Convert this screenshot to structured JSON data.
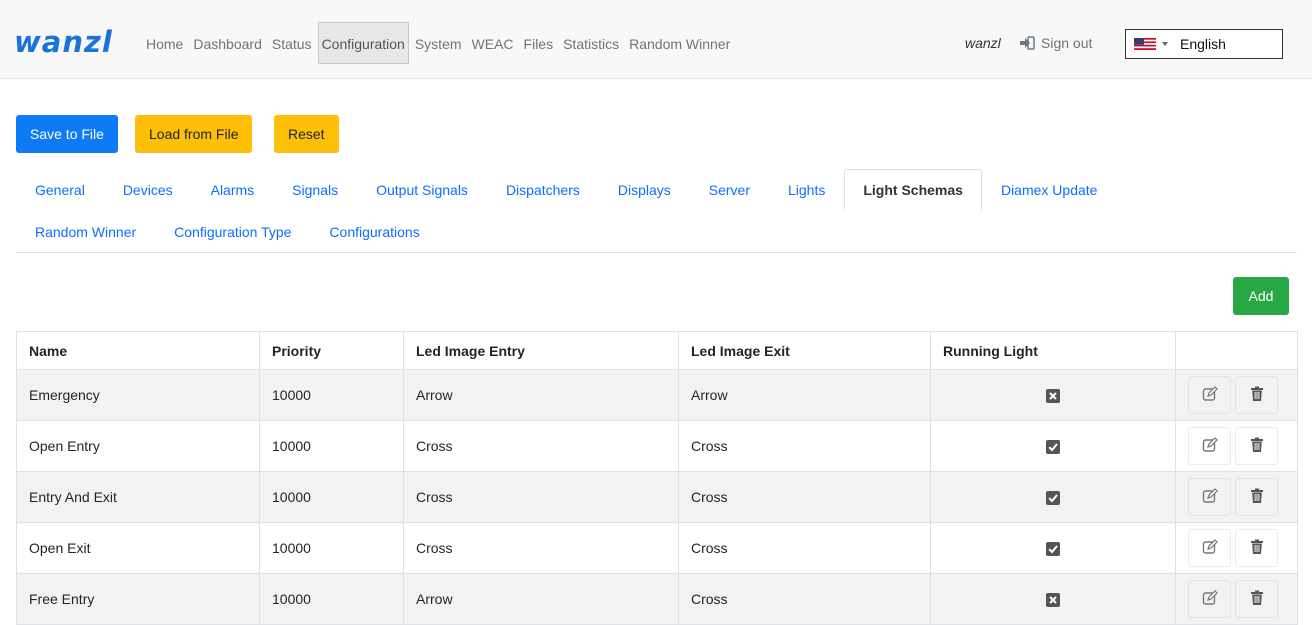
{
  "brand": "wanzl",
  "nav": {
    "links": [
      "Home",
      "Dashboard",
      "Status",
      "Configuration",
      "System",
      "WEAC",
      "Files",
      "Statistics",
      "Random Winner"
    ],
    "active_index": 3,
    "user": "wanzl",
    "signout": "Sign out",
    "language": "English"
  },
  "actions": {
    "save": "Save to File",
    "load": "Load from File",
    "reset": "Reset"
  },
  "tabs": {
    "row1": [
      "General",
      "Devices",
      "Alarms",
      "Signals",
      "Output Signals",
      "Dispatchers",
      "Displays",
      "Server",
      "Lights",
      "Light Schemas",
      "Diamex Update"
    ],
    "row2": [
      "Random Winner",
      "Configuration Type",
      "Configurations"
    ],
    "active": "Light Schemas"
  },
  "add_label": "Add",
  "table": {
    "headers": [
      "Name",
      "Priority",
      "Led Image Entry",
      "Led Image Exit",
      "Running Light",
      ""
    ],
    "rows": [
      {
        "name": "Emergency",
        "priority": "10000",
        "entry": "Arrow",
        "exit": "Arrow",
        "running": false
      },
      {
        "name": "Open Entry",
        "priority": "10000",
        "entry": "Cross",
        "exit": "Cross",
        "running": true
      },
      {
        "name": "Entry And Exit",
        "priority": "10000",
        "entry": "Cross",
        "exit": "Cross",
        "running": true
      },
      {
        "name": "Open Exit",
        "priority": "10000",
        "entry": "Cross",
        "exit": "Cross",
        "running": true
      },
      {
        "name": "Free Entry",
        "priority": "10000",
        "entry": "Arrow",
        "exit": "Cross",
        "running": false
      }
    ]
  },
  "colors": {
    "brand": "#1a73d9",
    "primary": "#0d7bf6",
    "warning": "#fec007",
    "success": "#28a745",
    "link": "#0d6efd"
  },
  "icons": {
    "signout": "sign-out-icon",
    "flag": "us-flag-icon",
    "edit": "edit-icon",
    "delete": "trash-icon",
    "checked": "checked-box-icon",
    "unchecked": "x-box-icon"
  }
}
